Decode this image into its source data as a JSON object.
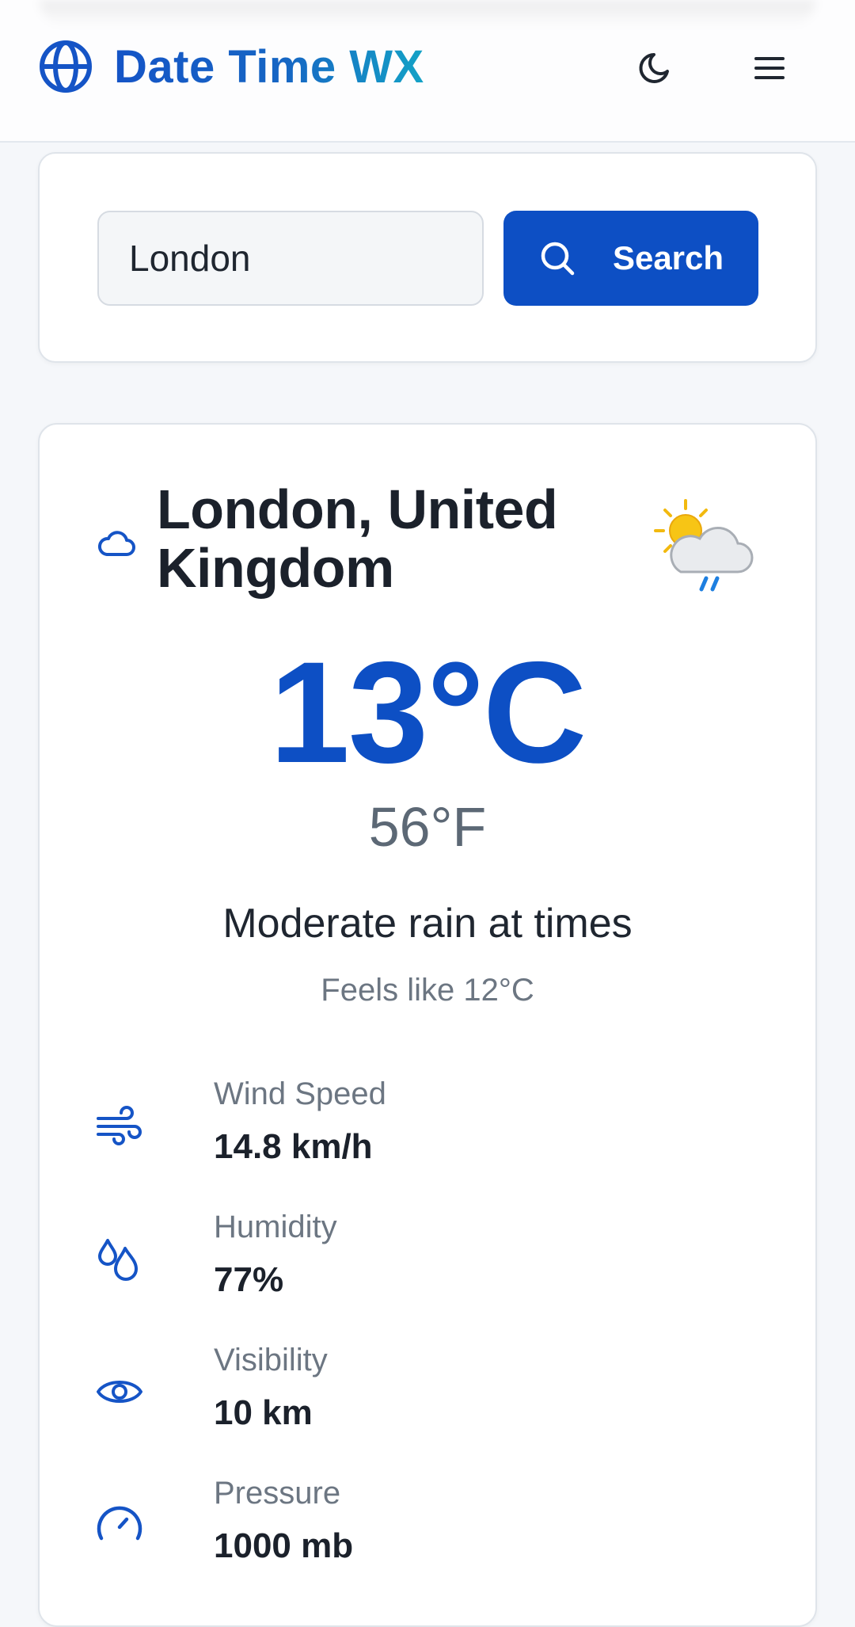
{
  "header": {
    "brand_title": "Date Time WX",
    "icons": {
      "brand": "globe-icon",
      "theme": "moon-icon",
      "menu": "hamburger-menu-icon"
    }
  },
  "search": {
    "value": "London",
    "button_label": "Search",
    "icon": "search-icon"
  },
  "weather": {
    "location": "London, United Kingdom",
    "location_icon": "cloud-icon",
    "condition_icon": "sun-behind-rain-cloud-icon",
    "temp_c": "13°C",
    "temp_f": "56°F",
    "condition": "Moderate rain at times",
    "feels_like": "Feels like 12°C",
    "stats": [
      {
        "icon": "wind-icon",
        "label": "Wind Speed",
        "value": "14.8 km/h"
      },
      {
        "icon": "droplets-icon",
        "label": "Humidity",
        "value": "77%"
      },
      {
        "icon": "eye-icon",
        "label": "Visibility",
        "value": "10 km"
      },
      {
        "icon": "gauge-icon",
        "label": "Pressure",
        "value": "1000 mb"
      }
    ]
  },
  "colors": {
    "accent": "#0d4fc4",
    "brand_gradient_start": "#1554c6",
    "brand_gradient_end": "#14a2c6",
    "background": "#f5f7fa",
    "muted_text": "#6c7682"
  }
}
